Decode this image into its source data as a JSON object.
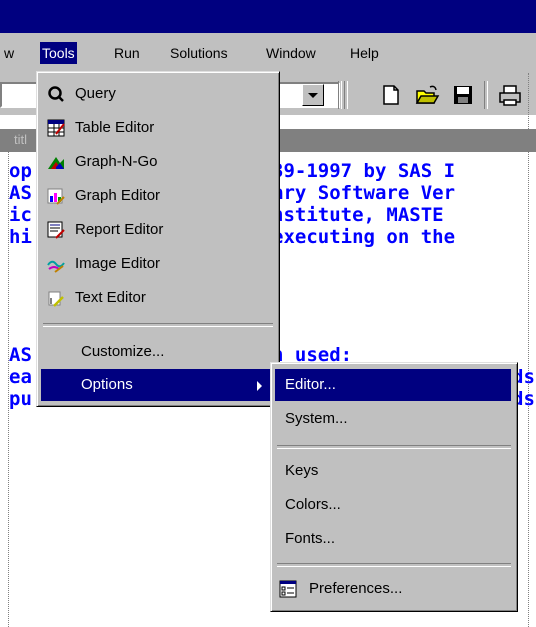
{
  "menubar": {
    "items": [
      {
        "label": "w"
      },
      {
        "label": "Tools"
      },
      {
        "label": "Run"
      },
      {
        "label": "Solutions"
      },
      {
        "label": "Window"
      },
      {
        "label": "Help"
      }
    ]
  },
  "editor": {
    "title_fragment": "titl",
    "lines": {
      "l1_left": "op",
      "l1_right": "39-1997 by SAS I",
      "l2_left": "AS",
      "l2_right": "ary Software Ver",
      "l3_left": "ic",
      "l3_right": "nstitute, MASTE",
      "l4_left": "hi",
      "l4_right": "executing on the",
      "l5_left": "AS",
      "l5_right": "n used:",
      "l6_left": "ea",
      "l6_right": "ds",
      "l7_left": "pu time",
      "l7_right": "ds"
    }
  },
  "tools_menu": {
    "items": [
      {
        "label": "Query",
        "icon": "query-icon"
      },
      {
        "label": "Table Editor",
        "icon": "table-editor-icon"
      },
      {
        "label": "Graph-N-Go",
        "icon": "graph-n-go-icon"
      },
      {
        "label": "Graph Editor",
        "icon": "graph-editor-icon"
      },
      {
        "label": "Report Editor",
        "icon": "report-editor-icon"
      },
      {
        "label": "Image Editor",
        "icon": "image-editor-icon"
      },
      {
        "label": "Text Editor",
        "icon": "text-editor-icon"
      },
      {
        "label": "Customize..."
      },
      {
        "label": "Options"
      }
    ]
  },
  "options_submenu": {
    "items": [
      {
        "label": "Editor..."
      },
      {
        "label": "System..."
      },
      {
        "label": "Keys"
      },
      {
        "label": "Colors..."
      },
      {
        "label": "Fonts..."
      },
      {
        "label": "Preferences...",
        "icon": "preferences-icon"
      }
    ]
  },
  "colors": {
    "title_bar": "#000080",
    "highlight": "#000080",
    "face": "#c0c0c0",
    "code_text": "#0000ff"
  }
}
